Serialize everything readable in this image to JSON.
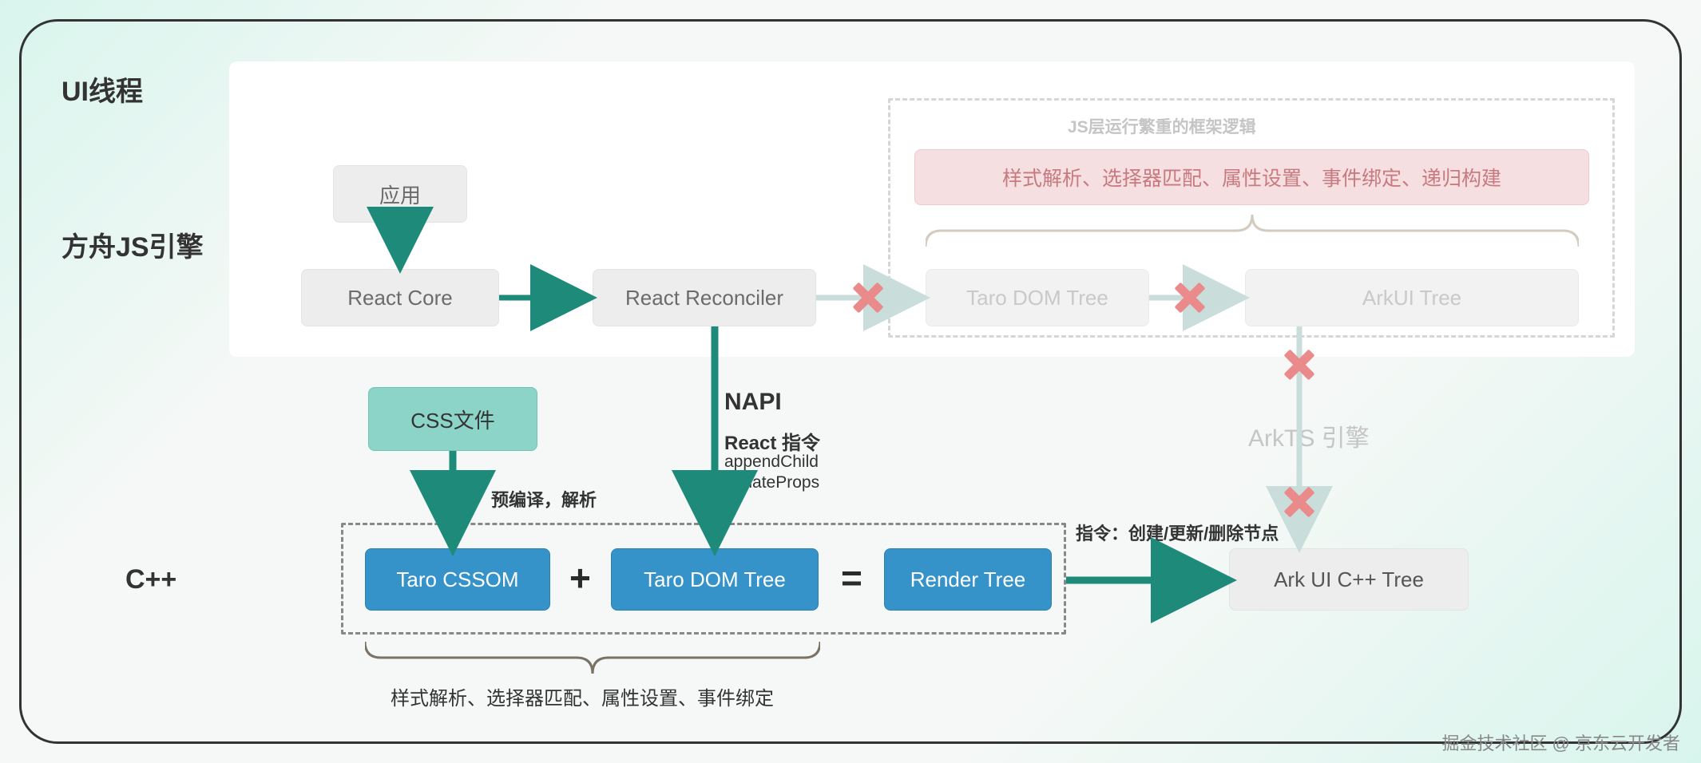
{
  "labels": {
    "ui_thread": "UI线程",
    "ark_js_engine": "方舟JS引擎",
    "cpp": "C++",
    "napi": "NAPI",
    "react_instr": "React 指令",
    "append_child": "appendChild",
    "update_props": "updateProps",
    "ellipsis": "…",
    "precompile": "预编译，解析",
    "instr_nodes": "指令：创建/更新/删除节点",
    "arkts_engine": "ArkTS 引擎",
    "js_heavy_logic": "JS层运行繁重的框架逻辑",
    "brace_bottom": "样式解析、选择器匹配、属性设置、事件绑定",
    "plus": "+",
    "equals": "="
  },
  "boxes": {
    "app": "应用",
    "react_core": "React Core",
    "react_reconciler": "React Reconciler",
    "taro_dom_tree_top": "Taro DOM Tree",
    "arkui_tree": "ArkUI Tree",
    "css_file": "CSS文件",
    "taro_cssom": "Taro CSSOM",
    "taro_dom_tree": "Taro DOM Tree",
    "render_tree": "Render Tree",
    "ark_ui_cpp": "Ark UI C++ Tree",
    "pink_ops": "样式解析、选择器匹配、属性设置、事件绑定、递归构建"
  },
  "watermark": "掘金技术社区 @ 京东云开发者"
}
